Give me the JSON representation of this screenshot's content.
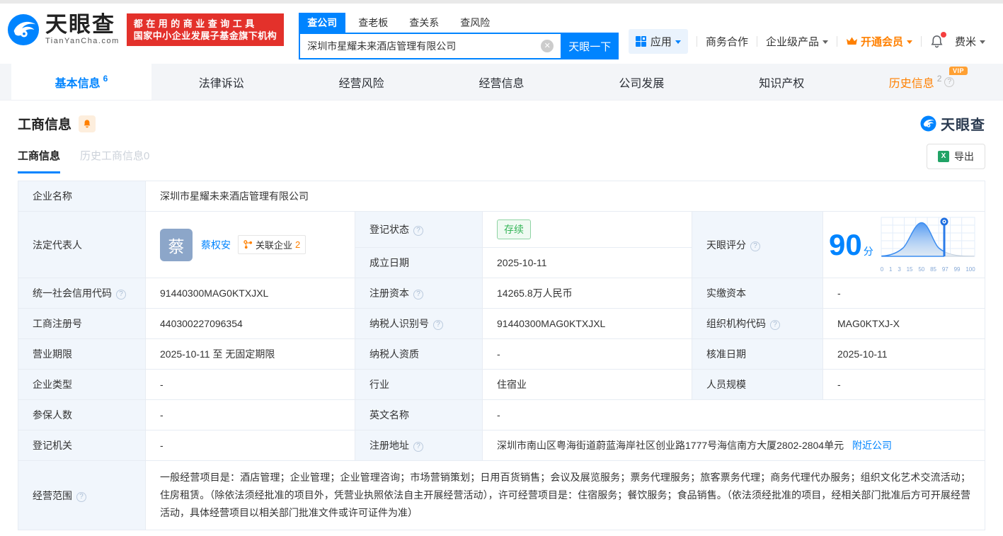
{
  "header": {
    "logo_title": "天眼查",
    "logo_domain": "TianYanCha.com",
    "slogan_line1": "都在用的商业查询工具",
    "slogan_line2": "国家中小企业发展子基金旗下机构",
    "search_tabs": [
      {
        "label": "查公司"
      },
      {
        "label": "查老板"
      },
      {
        "label": "查关系"
      },
      {
        "label": "查风险"
      }
    ],
    "search_value": "深圳市星耀未来酒店管理有限公司",
    "search_button": "天眼一下",
    "menu_apps": "应用",
    "menu_coop": "商务合作",
    "menu_enterprise": "企业级产品",
    "menu_vip": "开通会员",
    "menu_user": "费米"
  },
  "nav_tabs": [
    {
      "label": "基本信息",
      "count": "6"
    },
    {
      "label": "法律诉讼"
    },
    {
      "label": "经营风险"
    },
    {
      "label": "经营信息"
    },
    {
      "label": "公司发展"
    },
    {
      "label": "知识产权"
    },
    {
      "label": "历史信息",
      "count": "2",
      "vip": "VIP"
    }
  ],
  "section": {
    "title": "工商信息",
    "subtab_current": "工商信息",
    "subtab_history": "历史工商信息0",
    "export_label": "导出",
    "watermark": "天眼查"
  },
  "score": {
    "label": "天眼评分",
    "value": "90",
    "unit": "分"
  },
  "score_chart": {
    "type": "area",
    "ticks": [
      "0",
      "1",
      "3",
      "15",
      "50",
      "85",
      "97",
      "99",
      "100"
    ],
    "marker_value": 90
  },
  "biz": {
    "company_name": {
      "label": "企业名称",
      "value": "深圳市星耀未来酒店管理有限公司"
    },
    "legal_rep": {
      "label": "法定代表人",
      "avatar": "蔡",
      "name": "蔡权安",
      "related_label": "关联企业",
      "related_count": "2"
    },
    "reg_status": {
      "label": "登记状态",
      "value": "存续"
    },
    "establish_date": {
      "label": "成立日期",
      "value": "2025-10-11"
    },
    "credit_code": {
      "label": "统一社会信用代码",
      "value": "91440300MAG0KTXJXL"
    },
    "reg_capital": {
      "label": "注册资本",
      "value": "14265.8万人民币"
    },
    "paid_capital": {
      "label": "实缴资本",
      "value": "-"
    },
    "reg_number": {
      "label": "工商注册号",
      "value": "440300227096354"
    },
    "taxpayer_id": {
      "label": "纳税人识别号",
      "value": "91440300MAG0KTXJXL"
    },
    "org_code": {
      "label": "组织机构代码",
      "value": "MAG0KTXJ-X"
    },
    "biz_term": {
      "label": "营业期限",
      "value": "2025-10-11 至 无固定期限"
    },
    "taxpayer_quality": {
      "label": "纳税人资质",
      "value": "-"
    },
    "approval_date": {
      "label": "核准日期",
      "value": "2025-10-11"
    },
    "company_type": {
      "label": "企业类型",
      "value": "-"
    },
    "industry": {
      "label": "行业",
      "value": "住宿业"
    },
    "staff_size": {
      "label": "人员规模",
      "value": "-"
    },
    "insured_count": {
      "label": "参保人数",
      "value": "-"
    },
    "english_name": {
      "label": "英文名称",
      "value": "-"
    },
    "reg_authority": {
      "label": "登记机关",
      "value": "-"
    },
    "reg_address": {
      "label": "注册地址",
      "value": "深圳市南山区粤海街道蔚蓝海岸社区创业路1777号海信南方大厦2802-2804单元",
      "nearby_link": "附近公司"
    },
    "biz_scope": {
      "label": "经营范围",
      "value": "一般经营项目是：酒店管理；企业管理；企业管理咨询；市场营销策划；日用百货销售；会议及展览服务；票务代理服务；旅客票务代理；商务代理代办服务；组织文化艺术交流活动；住房租赁。（除依法须经批准的项目外，凭营业执照依法自主开展经营活动），许可经营项目是：住宿服务；餐饮服务；食品销售。（依法须经批准的项目，经相关部门批准后方可开展经营活动，具体经营项目以相关部门批准文件或许可证件为准）"
    }
  },
  "colors": {
    "brand_blue": "#0084ff",
    "brand_red": "#e3312b",
    "vip_orange": "#ff8000",
    "status_green": "#35b558"
  }
}
